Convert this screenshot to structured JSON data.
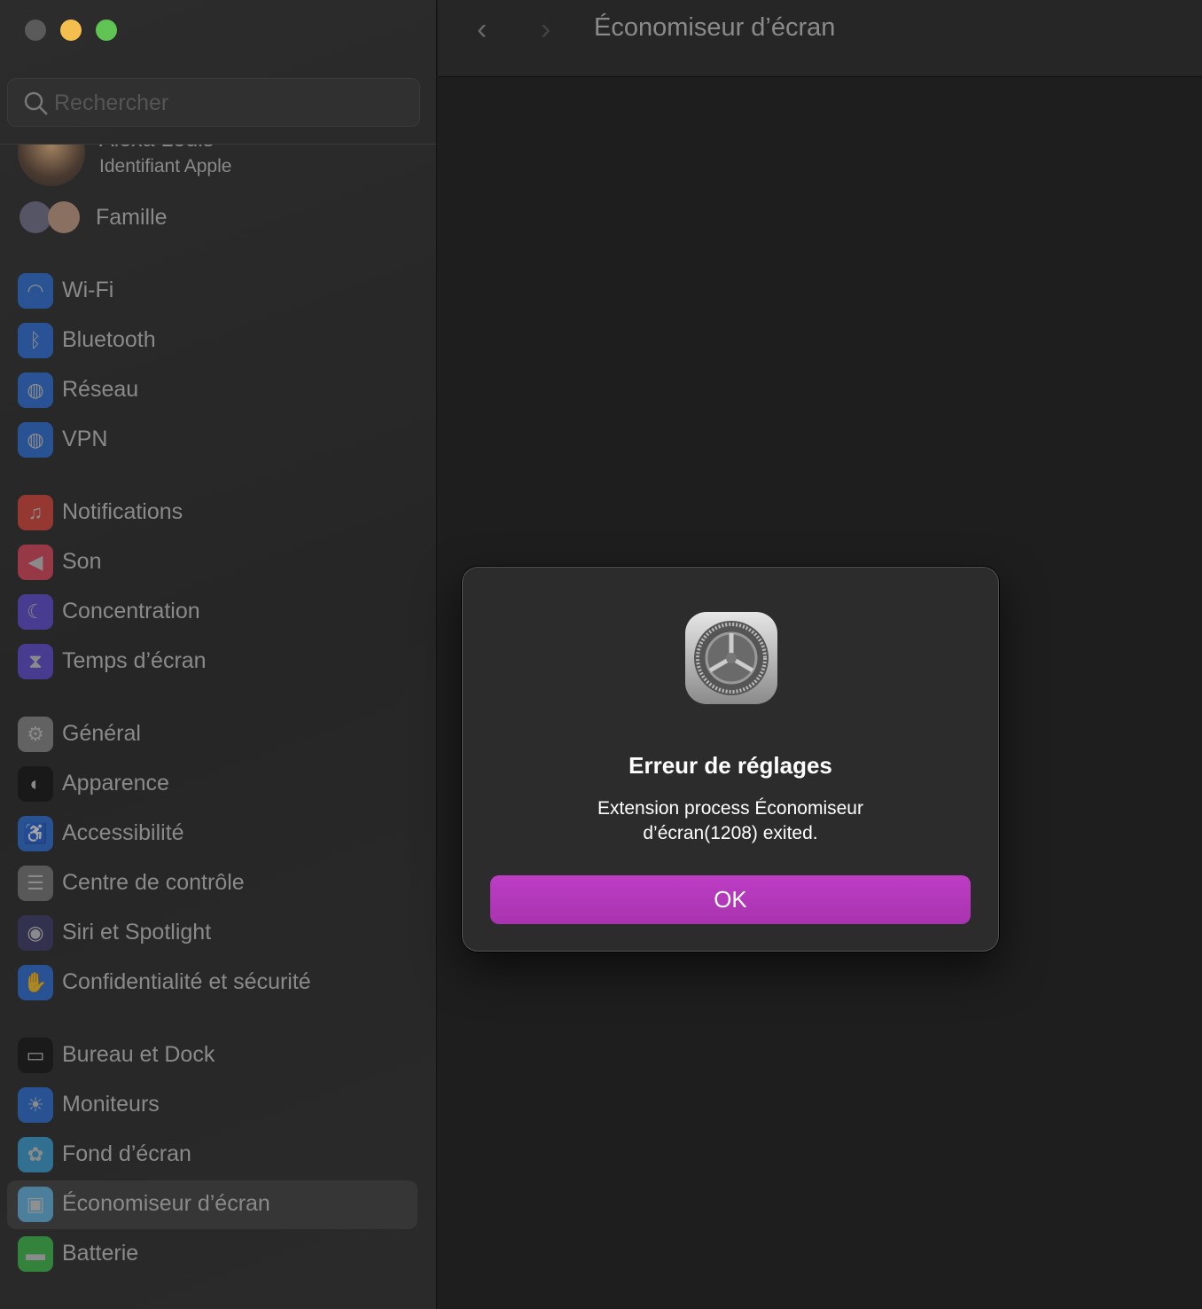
{
  "window": {
    "title": "Économiseur d’écran"
  },
  "search": {
    "placeholder": "Rechercher"
  },
  "account": {
    "name": "Alexa Louis",
    "subtitle": "Identifiant Apple",
    "family": "Famille"
  },
  "sidebar": {
    "groups": [
      [
        {
          "label": "Wi-Fi",
          "icon": "wifi-icon",
          "color": "#2a6fdb",
          "glyph": "◠"
        },
        {
          "label": "Bluetooth",
          "icon": "bluetooth-icon",
          "color": "#2a6fdb",
          "glyph": "ᛒ"
        },
        {
          "label": "Réseau",
          "icon": "globe-icon",
          "color": "#2a6fdb",
          "glyph": "◍"
        },
        {
          "label": "VPN",
          "icon": "vpn-globe-icon",
          "color": "#2a6fdb",
          "glyph": "◍"
        }
      ],
      [
        {
          "label": "Notifications",
          "icon": "bell-icon",
          "color": "#e0443a",
          "glyph": "♫"
        },
        {
          "label": "Son",
          "icon": "speaker-icon",
          "color": "#e0445a",
          "glyph": "◀"
        },
        {
          "label": "Concentration",
          "icon": "moon-icon",
          "color": "#5e4ad6",
          "glyph": "☾"
        },
        {
          "label": "Temps d’écran",
          "icon": "hourglass-icon",
          "color": "#5e4ad6",
          "glyph": "⧗"
        }
      ],
      [
        {
          "label": "Général",
          "icon": "gear-icon",
          "color": "#8a8a8a",
          "glyph": "⚙"
        },
        {
          "label": "Apparence",
          "icon": "appearance-icon",
          "color": "#111111",
          "glyph": "◐"
        },
        {
          "label": "Accessibilité",
          "icon": "accessibility-icon",
          "color": "#2a6fdb",
          "glyph": "♿"
        },
        {
          "label": "Centre de contrôle",
          "icon": "toggles-icon",
          "color": "#7a7a7a",
          "glyph": "☰"
        },
        {
          "label": "Siri et Spotlight",
          "icon": "siri-icon",
          "color": "#3a3a6a",
          "glyph": "◉"
        },
        {
          "label": "Confidentialité et sécurité",
          "icon": "hand-icon",
          "color": "#2a6fdb",
          "glyph": "✋"
        }
      ],
      [
        {
          "label": "Bureau et Dock",
          "icon": "dock-icon",
          "color": "#111111",
          "glyph": "▭"
        },
        {
          "label": "Moniteurs",
          "icon": "sun-icon",
          "color": "#2a6fdb",
          "glyph": "☀"
        },
        {
          "label": "Fond d’écran",
          "icon": "flower-icon",
          "color": "#38a0d8",
          "glyph": "✿"
        },
        {
          "label": "Économiseur d’écran",
          "icon": "screensaver-icon",
          "color": "#5ab0e0",
          "glyph": "▣",
          "selected": true
        },
        {
          "label": "Batterie",
          "icon": "battery-icon",
          "color": "#3cbf4a",
          "glyph": "▬"
        }
      ]
    ]
  },
  "dialog": {
    "title": "Erreur de réglages",
    "message": "Extension process Économiseur d’écran(1208) exited.",
    "ok_label": "OK",
    "accent": "#b83bbf"
  },
  "traffic_lights": {
    "close": "#5a5a5a",
    "minimize": "#f5bf4f",
    "zoom": "#5fc454"
  }
}
